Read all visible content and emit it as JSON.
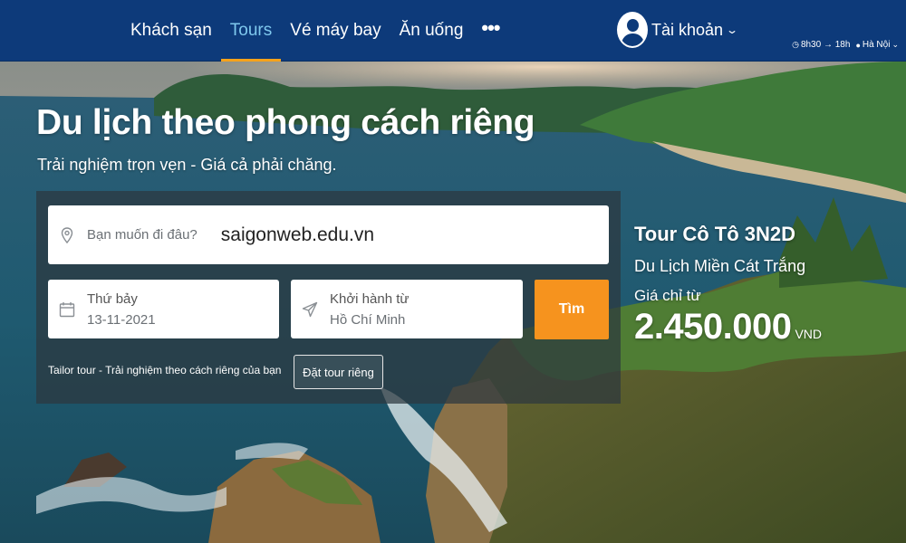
{
  "nav": {
    "items": [
      {
        "label": "Khách sạn",
        "active": false
      },
      {
        "label": "Tours",
        "active": true
      },
      {
        "label": "Vé máy bay",
        "active": false
      },
      {
        "label": "Ăn uống",
        "active": false
      }
    ],
    "more_label": "•••",
    "account_label": "Tài khoản",
    "hours": "8h30 → 18h",
    "location": "Hà Nội"
  },
  "hero": {
    "title": "Du lịch theo phong cách riêng",
    "subtitle": "Trải nghiệm trọn vẹn - Giá cả phải chăng."
  },
  "search": {
    "destination_placeholder": "Bạn muốn đi đâu?",
    "destination_value": "saigonweb.edu.vn",
    "date_label": "Thứ bảy",
    "date_value": "13-11-2021",
    "depart_label": "Khởi hành từ",
    "depart_value": "Hồ Chí Minh",
    "search_button": "Tìm",
    "tailor_text": "Tailor tour - Trải nghiệm theo cách riêng của bạn",
    "tailor_button": "Đặt tour riêng"
  },
  "promo": {
    "title": "Tour Cô Tô 3N2D",
    "subtitle": "Du Lịch Miền Cát Trắng",
    "price_from": "Giá chỉ từ",
    "price": "2.450.000",
    "currency": "VND"
  },
  "colors": {
    "nav_bg": "#0d3a7a",
    "nav_active": "#7fc8ee",
    "accent": "#f6931e"
  }
}
